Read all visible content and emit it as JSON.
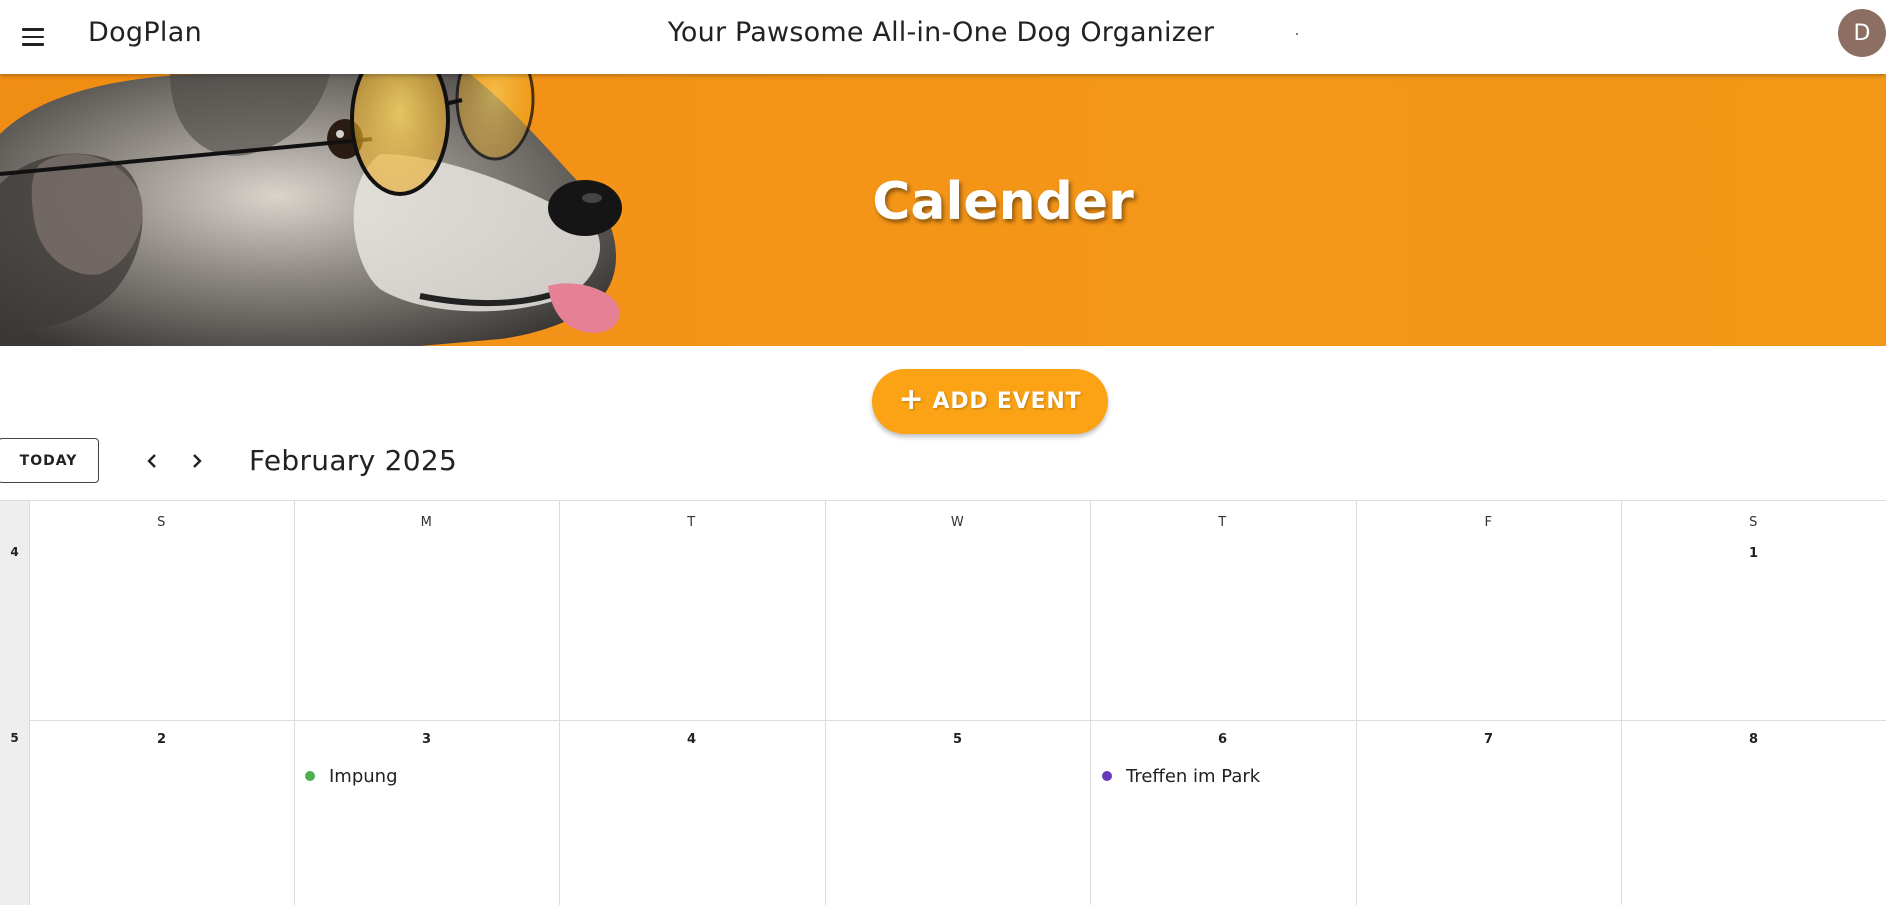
{
  "appbar": {
    "brand": "DogPlan",
    "title": "Your Pawsome All-in-One Dog Organizer",
    "avatar_initial": "D",
    "menu_icon": "hamburger-menu-icon"
  },
  "hero": {
    "title": "Calender",
    "background_color": "#f39417"
  },
  "actions": {
    "add_event_label": "ADD EVENT",
    "add_event_color": "#fba315"
  },
  "toolbar": {
    "today_label": "TODAY",
    "prev_icon": "chevron-left-icon",
    "next_icon": "chevron-right-icon",
    "month_label": "February 2025"
  },
  "calendar": {
    "weekdays": [
      "S",
      "M",
      "T",
      "W",
      "T",
      "F",
      "S"
    ],
    "weeks": [
      {
        "number": "4",
        "days": [
          "",
          "",
          "",
          "",
          "",
          "",
          "1"
        ]
      },
      {
        "number": "5",
        "days": [
          "2",
          "3",
          "4",
          "5",
          "6",
          "7",
          "8"
        ]
      }
    ],
    "events": [
      {
        "title": "Impung",
        "color": "#4caf50"
      },
      {
        "title": "Treffen im Park",
        "color": "#673ab7"
      }
    ]
  }
}
